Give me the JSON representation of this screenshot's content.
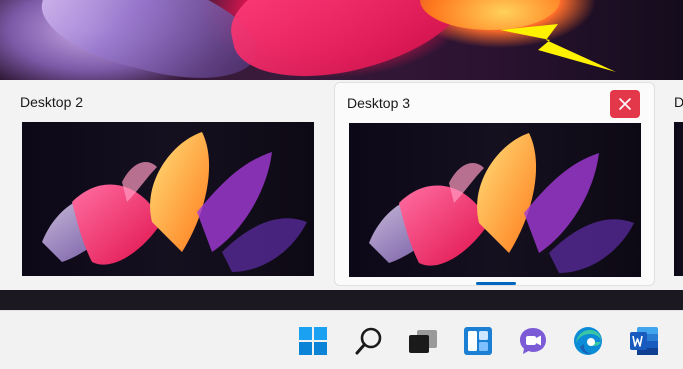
{
  "task_view": {
    "desktops": [
      {
        "label": "Desktop 2",
        "active": false
      },
      {
        "label": "Desktop 3",
        "active": true
      },
      {
        "label": "D",
        "active": false
      }
    ]
  },
  "close_button": {
    "icon": "close-icon",
    "color": "#e3384a"
  },
  "accent_color": "#0067c0",
  "taskbar": {
    "icons": [
      {
        "name": "start",
        "icon": "windows-logo-icon"
      },
      {
        "name": "search",
        "icon": "search-icon"
      },
      {
        "name": "task-view",
        "icon": "task-view-icon"
      },
      {
        "name": "widgets",
        "icon": "widgets-icon"
      },
      {
        "name": "teams-chat",
        "icon": "teams-chat-icon"
      },
      {
        "name": "edge",
        "icon": "edge-browser-icon"
      },
      {
        "name": "word",
        "icon": "word-icon"
      }
    ]
  }
}
